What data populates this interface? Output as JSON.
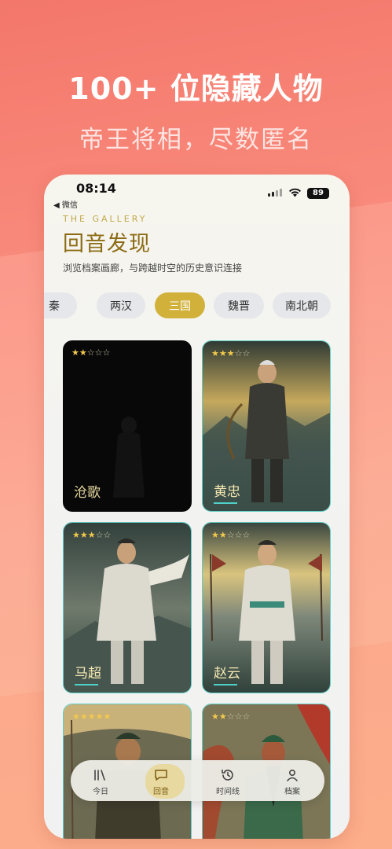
{
  "promo": {
    "headline": "100+ 位隐藏人物",
    "subheadline": "帝王将相，尽数匿名"
  },
  "status_bar": {
    "time": "08:14",
    "back_label": "◀ 微信",
    "battery": "89"
  },
  "header": {
    "gallery_tag": "THE GALLERY",
    "title": "回音发现",
    "description": "浏览档案画廊，与跨越时空的历史意识连接"
  },
  "dynasty_tabs": [
    {
      "label": "秦",
      "active": false
    },
    {
      "label": "两汉",
      "active": false
    },
    {
      "label": "三国",
      "active": true
    },
    {
      "label": "魏晋",
      "active": false
    },
    {
      "label": "南北朝",
      "active": false
    }
  ],
  "cards": [
    {
      "name": "沧歌",
      "stars": 2,
      "locked": true
    },
    {
      "name": "黄忠",
      "stars": 3,
      "locked": false
    },
    {
      "name": "马超",
      "stars": 3,
      "locked": false
    },
    {
      "name": "赵云",
      "stars": 2,
      "locked": false
    },
    {
      "name": "",
      "stars": 5,
      "locked": false
    },
    {
      "name": "",
      "stars": 2,
      "locked": false
    }
  ],
  "bottom_nav": [
    {
      "label": "今日",
      "icon": "library-icon",
      "active": false
    },
    {
      "label": "回音",
      "icon": "chat-bubble-icon",
      "active": true
    },
    {
      "label": "时间线",
      "icon": "history-clock-icon",
      "active": false
    },
    {
      "label": "档案",
      "icon": "profile-icon",
      "active": false
    }
  ],
  "colors": {
    "accent_gold": "#d1b13a",
    "title_gold": "#8c6b14",
    "card_border_teal": "#5dcfc8",
    "background_coral": "#f98b7c"
  }
}
